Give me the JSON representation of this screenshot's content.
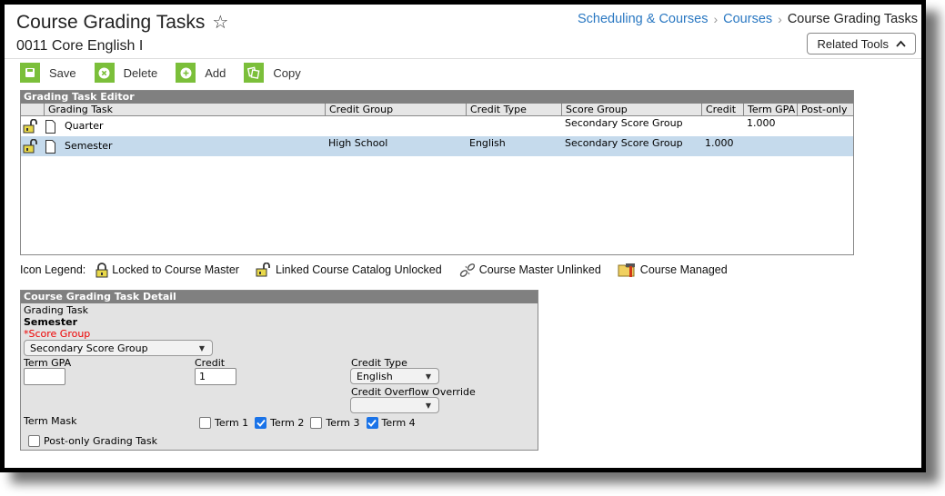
{
  "header": {
    "title": "Course Grading Tasks",
    "subtitle": "0011 Core English I",
    "breadcrumb": [
      "Scheduling & Courses",
      "Courses",
      "Course Grading Tasks"
    ],
    "related_tools": "Related Tools"
  },
  "toolbar": {
    "save": "Save",
    "delete": "Delete",
    "add": "Add",
    "copy": "Copy"
  },
  "editor": {
    "title": "Grading Task Editor",
    "columns": [
      "",
      "Grading Task",
      "Credit Group",
      "Credit Type",
      "Score Group",
      "Credit",
      "Term GPA",
      "Post-only"
    ],
    "rows": [
      {
        "task": "Quarter",
        "credit_group": "",
        "credit_type": "",
        "score_group": "Secondary Score Group",
        "credit": "",
        "term_gpa": "1.000",
        "post_only": "",
        "selected": false
      },
      {
        "task": "Semester",
        "credit_group": "High School",
        "credit_type": "English",
        "score_group": "Secondary Score Group",
        "credit": "1.000",
        "term_gpa": "",
        "post_only": "",
        "selected": true
      }
    ]
  },
  "legend": {
    "label": "Icon Legend:",
    "items": [
      "Locked to Course Master",
      "Linked Course Catalog Unlocked",
      "Course Master Unlinked",
      "Course Managed"
    ]
  },
  "detail": {
    "title": "Course Grading Task Detail",
    "grading_task_label": "Grading Task",
    "grading_task_value": "Semester",
    "score_group_label": "*Score Group",
    "score_group_value": "Secondary Score Group",
    "term_gpa_label": "Term GPA",
    "term_gpa_value": "",
    "credit_label": "Credit",
    "credit_value": "1",
    "credit_type_label": "Credit Type",
    "credit_type_value": "English",
    "credit_overflow_label": "Credit Overflow Override",
    "credit_overflow_value": "",
    "term_mask_label": "Term Mask",
    "terms": [
      {
        "label": "Term 1",
        "checked": false
      },
      {
        "label": "Term 2",
        "checked": true
      },
      {
        "label": "Term 3",
        "checked": false
      },
      {
        "label": "Term 4",
        "checked": true
      }
    ],
    "post_only_label": "Post-only Grading Task",
    "post_only_checked": false
  },
  "colors": {
    "accent_green": "#7bbf3a",
    "link_blue": "#2a78c2",
    "selected_row": "#c5daec",
    "required_red": "#e00000"
  }
}
